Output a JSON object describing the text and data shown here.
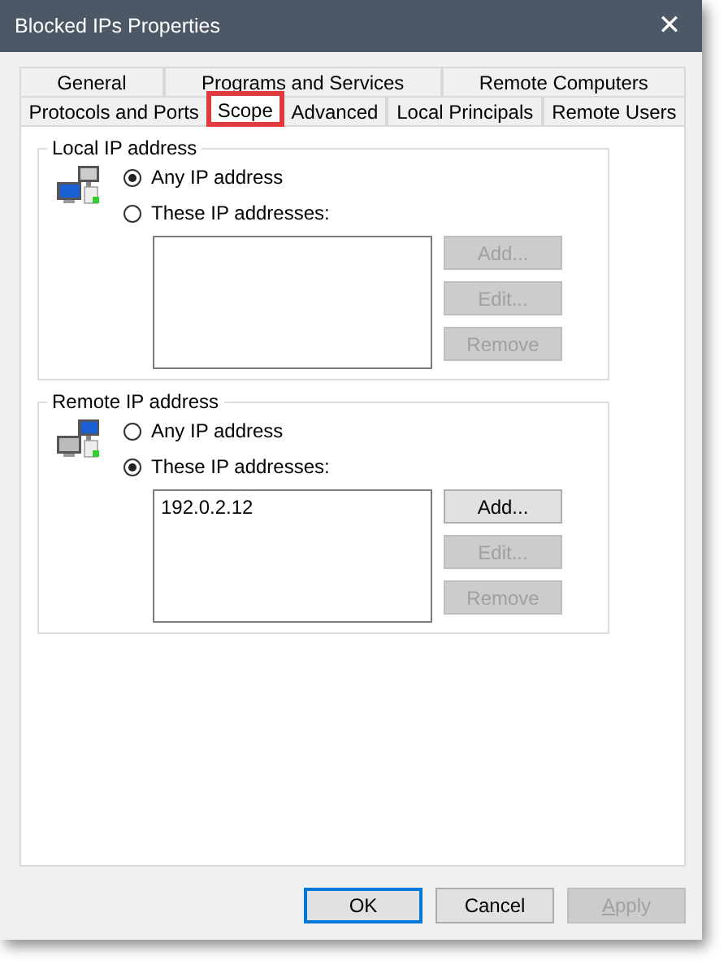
{
  "window": {
    "title": "Blocked IPs Properties",
    "close": "✕"
  },
  "tabs": [
    [
      {
        "label": "General",
        "selected": false,
        "highlighted": false
      },
      {
        "label": "Programs and Services",
        "selected": false,
        "highlighted": false
      },
      {
        "label": "Remote Computers",
        "selected": false,
        "highlighted": false
      }
    ],
    [
      {
        "label": "Protocols and Ports",
        "selected": false,
        "highlighted": false
      },
      {
        "label": "Scope",
        "selected": true,
        "highlighted": true
      },
      {
        "label": "Advanced",
        "selected": false,
        "highlighted": false
      },
      {
        "label": "Local Principals",
        "selected": false,
        "highlighted": false
      },
      {
        "label": "Remote Users",
        "selected": false,
        "highlighted": false
      }
    ]
  ],
  "groups": [
    {
      "legend": "Local IP address",
      "kind": "local",
      "radios": [
        {
          "label": "Any IP address",
          "selected": true
        },
        {
          "label": "These IP addresses:",
          "selected": false
        }
      ],
      "buttons": [
        {
          "label": "Add...",
          "disabled": true
        },
        {
          "label": "Edit...",
          "disabled": true
        },
        {
          "label": "Remove",
          "disabled": true
        }
      ]
    },
    {
      "legend": "Remote IP address",
      "kind": "remote",
      "radios": [
        {
          "label": "Any IP address",
          "selected": false
        },
        {
          "label": "These IP addresses:",
          "selected": true
        }
      ],
      "addresses": [
        "192.0.2.12"
      ],
      "buttons": [
        {
          "label": "Add...",
          "disabled": false
        },
        {
          "label": "Edit...",
          "disabled": true
        },
        {
          "label": "Remove",
          "disabled": true
        }
      ]
    }
  ],
  "footer": [
    {
      "label": "OK",
      "disabled": false,
      "default": true
    },
    {
      "label": "Cancel",
      "disabled": false,
      "default": false
    },
    {
      "label": "Apply",
      "disabled": true,
      "default": false
    }
  ]
}
